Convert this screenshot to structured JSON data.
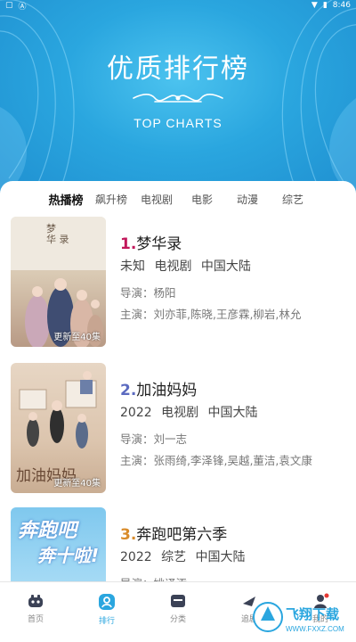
{
  "status_bar": {
    "left_icon": "a-icon",
    "time": "8:46"
  },
  "hero": {
    "title": "优质排行榜",
    "subtitle": "TOP CHARTS"
  },
  "tabs": [
    {
      "label": "热播榜",
      "active": true
    },
    {
      "label": "飙升榜",
      "active": false
    },
    {
      "label": "电视剧",
      "active": false
    },
    {
      "label": "电影",
      "active": false
    },
    {
      "label": "动漫",
      "active": false
    },
    {
      "label": "综艺",
      "active": false
    }
  ],
  "items": [
    {
      "rank": "1.",
      "rank_color": "#c2185b",
      "title": "梦华录",
      "meta": [
        "未知",
        "电视剧",
        "中国大陆"
      ],
      "director": "导演：杨阳",
      "cast": "主演：刘亦菲,陈晓,王彦霖,柳岩,林允",
      "poster_caption": "更新至40集",
      "poster_art_text": [
        "梦",
        "华",
        "录"
      ]
    },
    {
      "rank": "2.",
      "rank_color": "#5c6bc0",
      "title": "加油妈妈",
      "meta": [
        "2022",
        "电视剧",
        "中国大陆"
      ],
      "director": "导演：刘一志",
      "cast": "主演：张雨绮,李泽锋,吴越,董洁,袁文康",
      "poster_caption": "更新至40集",
      "poster_art_text": "加油妈妈"
    },
    {
      "rank": "3.",
      "rank_color": "#d98c2b",
      "title": "奔跑吧第六季",
      "meta": [
        "2022",
        "综艺",
        "中国大陆"
      ],
      "director": "导演：姚译添",
      "poster_art_text": [
        "奔跑吧",
        "奔十啦!"
      ]
    }
  ],
  "nav": [
    {
      "label": "首页",
      "icon": "home-icon",
      "active": false
    },
    {
      "label": "排行",
      "icon": "ranking-icon",
      "active": true
    },
    {
      "label": "分类",
      "icon": "category-icon",
      "active": false
    },
    {
      "label": "追剧",
      "icon": "follow-icon",
      "active": false
    },
    {
      "label": "我的",
      "icon": "profile-icon",
      "active": false
    }
  ],
  "watermark": {
    "text": "飞翔下载",
    "url_text": "WWW.FXXZ.COM"
  },
  "colors": {
    "accent": "#2aa6df",
    "hero_bg": "#2aa6df"
  }
}
